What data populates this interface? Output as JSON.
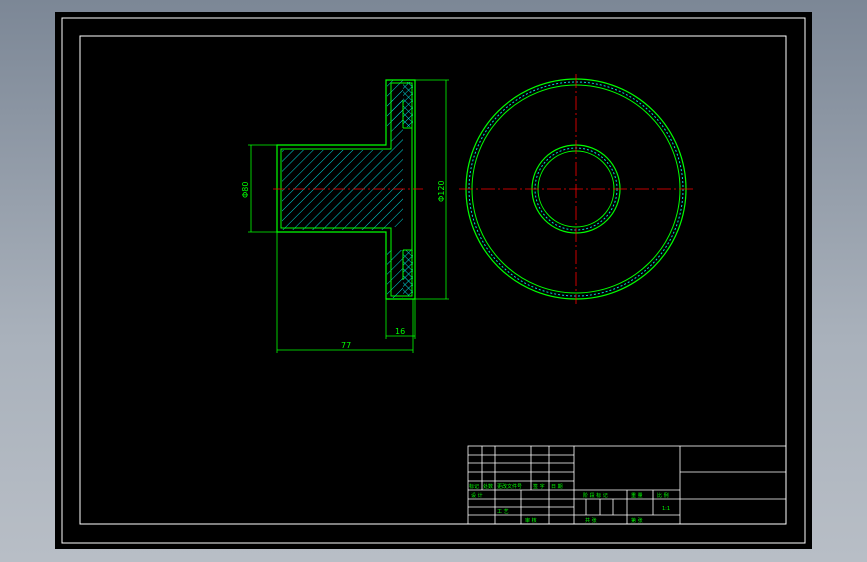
{
  "drawing": {
    "dimensions": {
      "inner_diameter": "Φ80",
      "outer_diameter": "Φ120",
      "total_length": "77",
      "flange_thickness": "16"
    },
    "title_block": {
      "header_cells": [
        "标记",
        "处数",
        "更改文件号",
        "签 字",
        "日 期"
      ],
      "designer_label": "设 计",
      "stage_label": "阶 段 标 记",
      "weight_label": "重 量",
      "scale_label": "比 例",
      "scale_value": "1:1",
      "approve_label": "审 核",
      "sheet_count_label": "共   张",
      "sheet_number_label": "第   张",
      "process_label": "工 艺"
    }
  },
  "colors": {
    "outline": "#ffffff",
    "geometry": "#00ff00",
    "hatch": "#00d8d8",
    "centerline": "#ff0000"
  }
}
